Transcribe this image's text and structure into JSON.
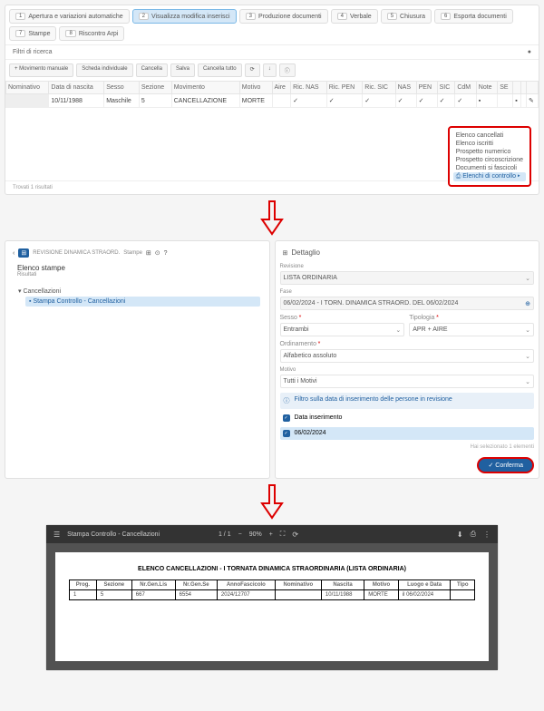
{
  "p1": {
    "tabs": [
      {
        "n": "1",
        "l": "Apertura e variazioni automatiche"
      },
      {
        "n": "2",
        "l": "Visualizza modifica inserisci"
      },
      {
        "n": "3",
        "l": "Produzione documenti"
      },
      {
        "n": "4",
        "l": "Verbale"
      },
      {
        "n": "5",
        "l": "Chiusura"
      },
      {
        "n": "6",
        "l": "Esporta documenti"
      },
      {
        "n": "7",
        "l": "Stampe"
      },
      {
        "n": "8",
        "l": "Riscontro Arpi"
      }
    ],
    "filter": "Filtri di ricerca",
    "actions": [
      "+ Movimento manuale",
      "Scheda individuale",
      "Cancella",
      "Salva",
      "Cancella tutto"
    ],
    "cols": [
      "Nominativo",
      "Data di nascita",
      "Sesso",
      "Sezione",
      "Movimento",
      "Motivo",
      "Aire",
      "Ric. NAS",
      "Ric. PEN",
      "Ric. SIC",
      "NAS",
      "PEN",
      "SIC",
      "CdM",
      "Note",
      "SE"
    ],
    "row": {
      "data": "10/11/1988",
      "sesso": "Maschile",
      "sez": "5",
      "mov": "CANCELLAZIONE",
      "motivo": "MORTE"
    },
    "popup": [
      "Elenco cancellati",
      "Elenco iscritti",
      "Prospetto numerico",
      "Prospetto circoscrizione",
      "Documenti si fascicoli",
      "Elenchi di controllo"
    ],
    "footer": "Trovati 1 risultati"
  },
  "p2": {
    "crumb": "REVISIONE DINAMICA STRAORD.",
    "ctitle": "Stampe",
    "ltitle": "Elenco stampe",
    "lsub": "Risultati",
    "tree": {
      "parent": "Cancellazioni",
      "child": "Stampa Controllo - Cancellazioni"
    },
    "rtitle": "Dettaglio",
    "fields": {
      "revisione": {
        "lbl": "Revisione",
        "val": "LISTA ORDINARIA"
      },
      "fase": {
        "lbl": "Fase",
        "val": "06/02/2024 - I TORN. DINAMICA STRAORD. DEL 06/02/2024"
      },
      "sesso": {
        "lbl": "Sesso",
        "val": "Entrambi"
      },
      "tipologia": {
        "lbl": "Tipologia",
        "val": "APR + AIRE"
      },
      "ordinamento": {
        "lbl": "Ordinamento",
        "val": "Alfabetico assoluto"
      },
      "motivo": {
        "lbl": "Motivo",
        "val": "Tutti i Motivi"
      }
    },
    "info": "Filtro sulla data di inserimento delle persone in revisione",
    "chk1": "Data inserimento",
    "chk2": "06/02/2024",
    "selinfo": "Hai selezionato 1 elementi",
    "conf": "Conferma"
  },
  "p3": {
    "title": "Stampa Controllo - Cancellazioni",
    "page": "1 / 1",
    "zoom": "90%",
    "heading": "ELENCO CANCELLAZIONI - I TORNATA DINAMICA STRAORDINARIA (LISTA ORDINARIA)",
    "cols": [
      "Prog.",
      "Sezione",
      "Nr.Gen.Lis",
      "Nr.Gen.Se",
      "AnnoFascicolo",
      "Nominativo",
      "Nascita",
      "Motivo",
      "Luogo e Data",
      "Tipo"
    ],
    "row": [
      "1",
      "5",
      "667",
      "6554",
      "2024/12707",
      "",
      "10/11/1988",
      "MORTE",
      "il 06/02/2024",
      ""
    ]
  },
  "chart_data": {
    "type": "table",
    "title": "ELENCO CANCELLAZIONI - I TORNATA DINAMICA STRAORDINARIA (LISTA ORDINARIA)",
    "columns": [
      "Prog.",
      "Sezione",
      "Nr.Gen.Lis",
      "Nr.Gen.Se",
      "AnnoFascicolo",
      "Nominativo",
      "Nascita",
      "Motivo",
      "Luogo e Data",
      "Tipo"
    ],
    "rows": [
      [
        "1",
        "5",
        "667",
        "6554",
        "2024/12707",
        "",
        "10/11/1988",
        "MORTE",
        "il 06/02/2024",
        ""
      ]
    ]
  }
}
